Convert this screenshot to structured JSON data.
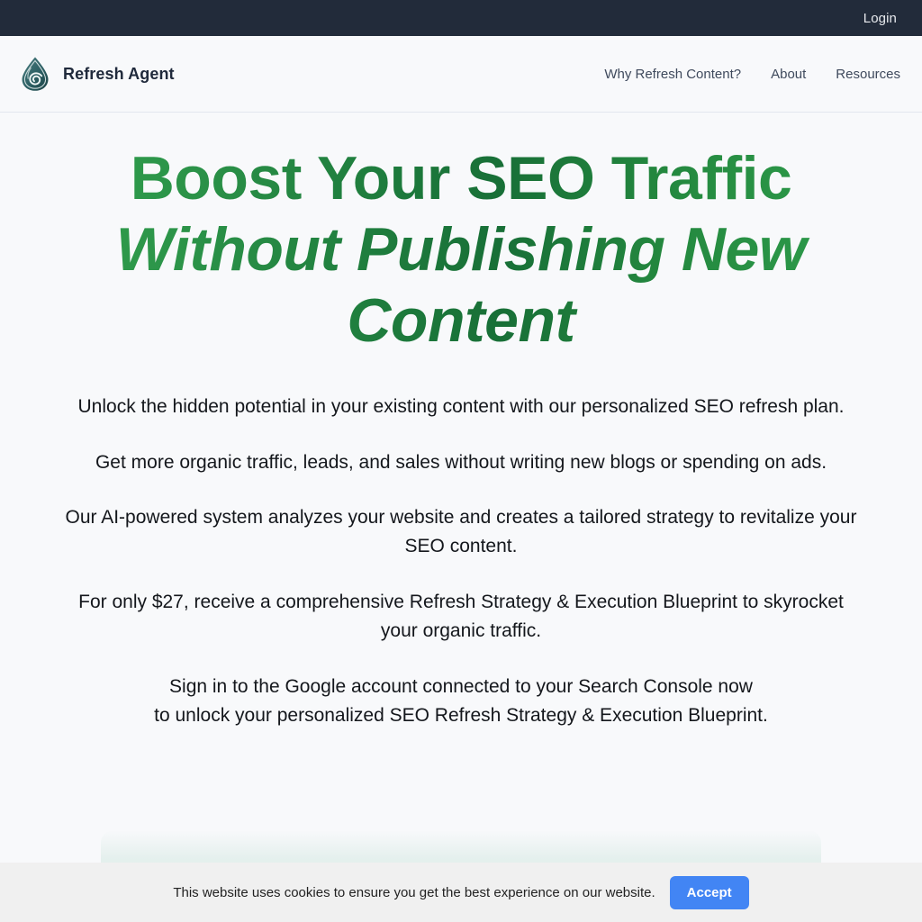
{
  "topbar": {
    "login_label": "Login"
  },
  "header": {
    "logo_icon": "water-drop-spiral-logo",
    "brand_name": "Refresh Agent",
    "nav": [
      {
        "label": "Why Refresh Content?",
        "name": "nav-link-why-refresh-content"
      },
      {
        "label": "About",
        "name": "nav-link-about"
      },
      {
        "label": "Resources",
        "name": "nav-link-resources"
      }
    ]
  },
  "hero": {
    "title_line1": "Boost Your SEO Traffic",
    "title_line2": "Without Publishing New",
    "title_line3": "Content",
    "paragraphs": [
      "Unlock the hidden potential in your existing content with our personalized SEO refresh plan.",
      "Get more organic traffic, leads, and sales without writing new blogs or spending on ads.",
      "Our AI-powered system analyzes your website and creates a tailored strategy to revitalize your SEO content.",
      "For only $27, receive a comprehensive Refresh Strategy & Execution Blueprint to skyrocket your organic traffic."
    ],
    "signin_line1": "Sign in to the Google account connected to your Search Console now",
    "signin_line2": "to unlock your personalized SEO Refresh Strategy & Execution Blueprint."
  },
  "cookie": {
    "message": "This website uses cookies to ensure you get the best experience on our website.",
    "accept_label": "Accept"
  },
  "colors": {
    "topbar_bg": "#222b3a",
    "page_bg": "#f8f9fb",
    "headline_green_light": "#2f9e4c",
    "headline_green_dark": "#186f37",
    "accept_blue": "#4285f4",
    "cookie_bar_bg": "#f0f0f0",
    "logo_teal": "#2c5f63"
  }
}
